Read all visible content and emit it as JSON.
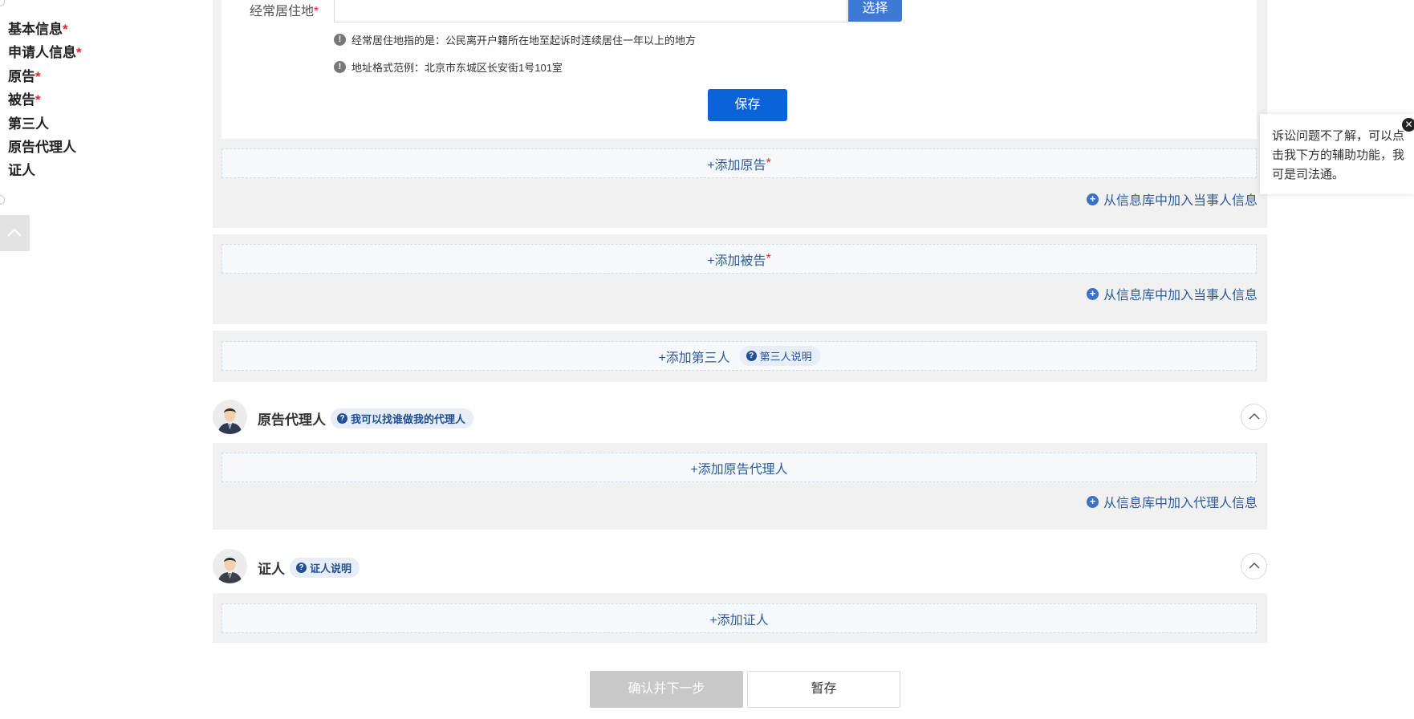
{
  "nav": {
    "items": [
      {
        "label": "基本信息",
        "required": "*"
      },
      {
        "label": "申请人信息",
        "required": "*"
      },
      {
        "label": "原告",
        "required": "*"
      },
      {
        "label": "被告",
        "required": "*"
      },
      {
        "label": "第三人",
        "required": ""
      },
      {
        "label": "原告代理人",
        "required": ""
      },
      {
        "label": "证人",
        "required": ""
      }
    ]
  },
  "form": {
    "residence_label": "经常居住地",
    "required_mark": "*",
    "residence_value": "",
    "select_label": "选择",
    "hint1": "经常居住地指的是：公民离开户籍所在地至起诉时连续居住一年以上的地方",
    "hint2": "地址格式范例：北京市东城区长安街1号101室",
    "save_label": "保存"
  },
  "plaintiff": {
    "add_label": "+添加原告",
    "required": "*",
    "library_link": "从信息库中加入当事人信息"
  },
  "defendant": {
    "add_label": "+添加被告",
    "required": "*",
    "library_link": "从信息库中加入当事人信息"
  },
  "third_party": {
    "add_label": "+添加第三人",
    "help_badge": "第三人说明"
  },
  "agent": {
    "title": "原告代理人",
    "help_badge": "我可以找谁做我的代理人",
    "add_label": "+添加原告代理人",
    "library_link": "从信息库中加入代理人信息"
  },
  "witness": {
    "title": "证人",
    "help_badge": "证人说明",
    "add_label": "+添加证人"
  },
  "footer": {
    "confirm_label": "确认并下一步",
    "draft_label": "暂存"
  },
  "assistant": {
    "text": "诉讼问题不了解，可以点击我下方的辅助功能，我可是司法通。"
  },
  "icons": {
    "info": "exclamation-icon",
    "help": "question-icon",
    "add": "plus-circle-icon",
    "collapse": "chevron-up-icon",
    "close": "close-icon"
  },
  "colors": {
    "primary": "#0c62d9",
    "link": "#2d5c9a",
    "required": "#e2262a",
    "panel": "#f1f1f1"
  }
}
